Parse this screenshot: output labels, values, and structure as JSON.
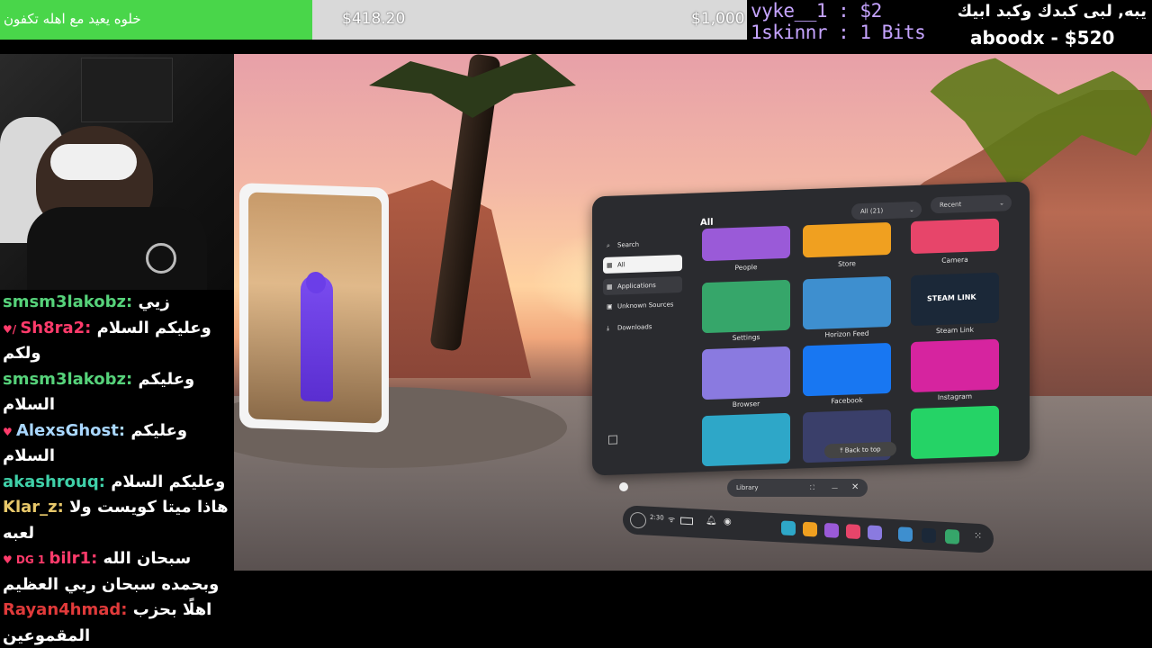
{
  "goal": {
    "title": "خلوه يعيد مع اهله تكفون",
    "current": "$418.20",
    "target": "$1,000",
    "progress_fraction": 0.418
  },
  "alerts": {
    "line1": "vyke__1 : $2",
    "line2": "1skinnr : 1 Bits",
    "line3": "يبه, لبى كبدك وكبد ابيك",
    "line4": "aboodx - $520"
  },
  "chat": [
    {
      "user": "smsm3lakobz",
      "color": "#56d27a",
      "text": "زيي",
      "badge": ""
    },
    {
      "user": "Sh8ra2",
      "color": "#ff3b6b",
      "text": "وعليكم السلام",
      "badge": "♥/"
    },
    {
      "user": "",
      "color": "#ffffff",
      "text": "ولكم",
      "badge": ""
    },
    {
      "user": "smsm3lakobz",
      "color": "#56d27a",
      "text": "وعليكم",
      "badge": ""
    },
    {
      "user": "",
      "color": "#ffffff",
      "text": "السلام",
      "badge": ""
    },
    {
      "user": "AlexsGhost",
      "color": "#a9d7ff",
      "text": "وعليكم",
      "badge": "♥"
    },
    {
      "user": "",
      "color": "#ffffff",
      "text": "السلام",
      "badge": ""
    },
    {
      "user": "akashrouq",
      "color": "#3fd0a8",
      "text": "وعليكم السلام",
      "badge": ""
    },
    {
      "user": "Klar_z",
      "color": "#e8c86a",
      "text": "هاذا ميتا كويست ولا",
      "badge": ""
    },
    {
      "user": "",
      "color": "#ffffff",
      "text": "لعبه",
      "badge": ""
    },
    {
      "user": "bilr1",
      "color": "#ff3b6b",
      "text": "سبحان الله",
      "badge": "♥ DG 1"
    },
    {
      "user": "",
      "color": "#ffffff",
      "text": "وبحمده سبحان ربي العظيم",
      "badge": ""
    },
    {
      "user": "Rayan4hmad",
      "color": "#e03a3a",
      "text": "اهلًا بحزب",
      "badge": ""
    },
    {
      "user": "",
      "color": "#ffffff",
      "text": "المقموعين",
      "badge": ""
    }
  ],
  "panel": {
    "header": "All",
    "filter": "All (21)",
    "sort": "Recent",
    "sidebar": [
      "Search",
      "All",
      "Applications",
      "Unknown Sources",
      "Downloads"
    ],
    "apps": [
      {
        "name": "People",
        "color": "#9a5ad8"
      },
      {
        "name": "Store",
        "color": "#f0a020"
      },
      {
        "name": "Camera",
        "color": "#e7456a"
      },
      {
        "name": "Settings",
        "color": "#36a66a"
      },
      {
        "name": "Horizon Feed",
        "color": "#3e8fcf"
      },
      {
        "name": "Steam Link",
        "color": "#1b2838"
      },
      {
        "name": "Browser",
        "color": "#8a7ae0"
      },
      {
        "name": "Facebook",
        "color": "#1877f2"
      },
      {
        "name": "Instagram",
        "color": "#d6249f"
      },
      {
        "name": "",
        "color": "#2ea7c8"
      },
      {
        "name": "",
        "color": "#3a3f6a"
      },
      {
        "name": "",
        "color": "#25d366"
      }
    ],
    "steam_label": "STEAM LINK",
    "back_to_top": "Back to top"
  },
  "library_bar": {
    "label": "Library"
  },
  "taskbar": {
    "time": "2:30"
  }
}
